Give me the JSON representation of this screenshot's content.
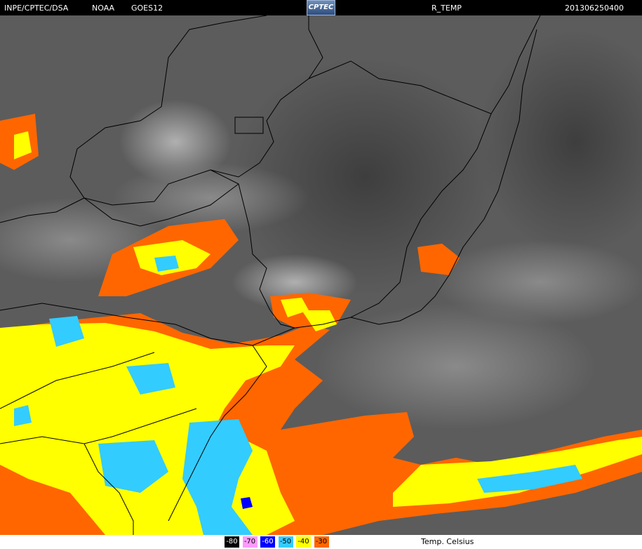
{
  "header": {
    "institution": "INPE/CPTEC/DSA",
    "agency": "NOAA",
    "satellite": "GOES12",
    "logo_text": "CPTEC",
    "product": "R_TEMP",
    "timestamp": "201306250400"
  },
  "legend": {
    "unit_label": "Temp. Celsius",
    "items": [
      {
        "label": "-80",
        "color": "#000000",
        "text_color": "#ffffff"
      },
      {
        "label": "-70",
        "color": "#ff99ff",
        "text_color": "#000000"
      },
      {
        "label": "-60",
        "color": "#0000ff",
        "text_color": "#ffffff"
      },
      {
        "label": "-50",
        "color": "#33ccff",
        "text_color": "#000000"
      },
      {
        "label": "-40",
        "color": "#ffff00",
        "text_color": "#000000"
      },
      {
        "label": "-30",
        "color": "#ff6600",
        "text_color": "#000000"
      }
    ]
  },
  "colors": {
    "background_cloud_gray": "#5a5a5a",
    "border_lines": "#000000"
  }
}
